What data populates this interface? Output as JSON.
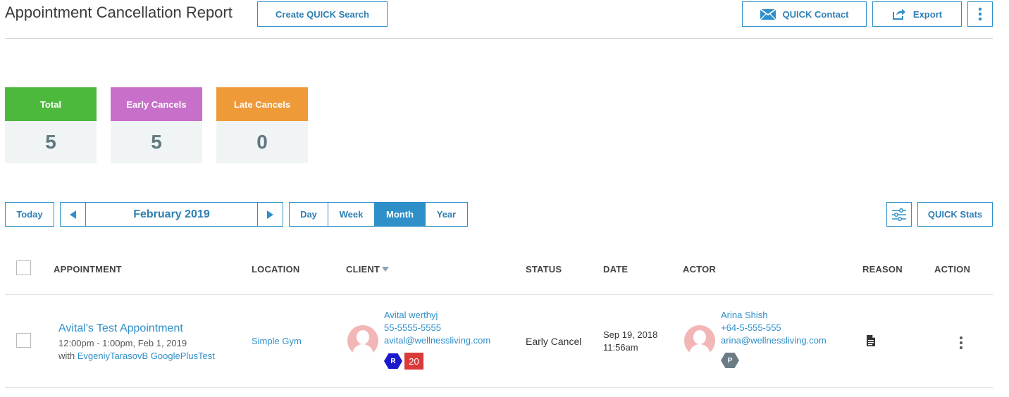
{
  "header": {
    "title": "Appointment Cancellation Report",
    "create_search_label": "Create QUICK Search",
    "quick_contact_label": "QUICK Contact",
    "export_label": "Export"
  },
  "stats": [
    {
      "label": "Total",
      "value": "5",
      "color": "#4cb83c"
    },
    {
      "label": "Early Cancels",
      "value": "5",
      "color": "#c86fca"
    },
    {
      "label": "Late Cancels",
      "value": "0",
      "color": "#ef9a38"
    }
  ],
  "nav": {
    "today_label": "Today",
    "period_label": "February 2019",
    "views": [
      "Day",
      "Week",
      "Month",
      "Year"
    ],
    "active_view": "Month",
    "quick_stats_label": "QUICK Stats"
  },
  "table": {
    "columns": {
      "appointment": "APPOINTMENT",
      "location": "LOCATION",
      "client": "CLIENT",
      "status": "STATUS",
      "date": "DATE",
      "actor": "ACTOR",
      "reason": "REASON",
      "action": "ACTION"
    },
    "rows": [
      {
        "appointment_title": "Avital's Test Appointment",
        "appointment_time": "12:00pm - 1:00pm, Feb 1, 2019",
        "with_prefix": "with",
        "with_name": "EvgeniyTarasovB GooglePlusTest",
        "location": "Simple Gym",
        "client_name": "Avital werthyj",
        "client_phone": "55-5555-5555",
        "client_email": "avital@wellnessliving.com",
        "client_badge_letter": "R",
        "client_badge_count": "20",
        "status": "Early Cancel",
        "date_line1": "Sep 19, 2018",
        "date_line2": "11:56am",
        "actor_name": "Arina Shish",
        "actor_phone": "+64-5-555-555",
        "actor_email": "arina@wellnessliving.com",
        "actor_badge_letter": "P"
      }
    ]
  },
  "colors": {
    "accent": "#2f8fc9",
    "badge_r": "#1a1acc",
    "badge_count": "#d93a3a",
    "badge_p": "#6c7c86"
  }
}
